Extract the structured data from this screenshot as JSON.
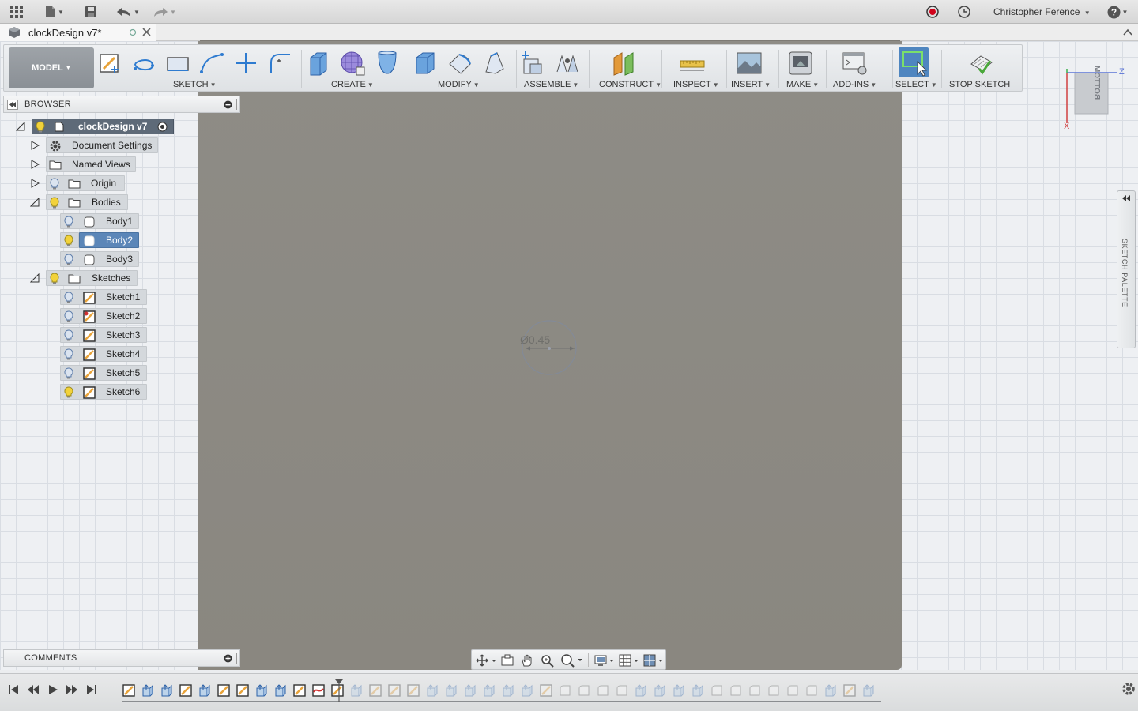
{
  "app": {
    "user_name": "Christopher Ference",
    "doc_tab_title": "clockDesign v7*"
  },
  "toolbar": {
    "workspace_label": "MODEL",
    "groups": [
      {
        "label": "SKETCH"
      },
      {
        "label": "CREATE"
      },
      {
        "label": "MODIFY"
      },
      {
        "label": "ASSEMBLE"
      },
      {
        "label": "CONSTRUCT"
      },
      {
        "label": "INSPECT"
      },
      {
        "label": "INSERT"
      },
      {
        "label": "MAKE"
      },
      {
        "label": "ADD-INS"
      },
      {
        "label": "SELECT"
      },
      {
        "label": "STOP SKETCH"
      }
    ]
  },
  "browser": {
    "title": "BROWSER",
    "root": "clockDesign v7",
    "items": [
      {
        "label": "Document Settings"
      },
      {
        "label": "Named Views"
      },
      {
        "label": "Origin"
      },
      {
        "label": "Bodies"
      },
      {
        "label": "Body1"
      },
      {
        "label": "Body2"
      },
      {
        "label": "Body3"
      },
      {
        "label": "Sketches"
      },
      {
        "label": "Sketch1"
      },
      {
        "label": "Sketch2"
      },
      {
        "label": "Sketch3"
      },
      {
        "label": "Sketch4"
      },
      {
        "label": "Sketch5"
      },
      {
        "label": "Sketch6"
      }
    ]
  },
  "comments": {
    "title": "COMMENTS"
  },
  "sketch_palette": {
    "label": "SKETCH PALETTE"
  },
  "viewport": {
    "dimension_text": "Ø0.45",
    "viewcube_face": "BOTTOM",
    "axis_z": "Z",
    "axis_x": "X"
  },
  "colors": {
    "accent": "#5b86b8",
    "solid_face": "#8b8983",
    "record": "#d0021b"
  }
}
